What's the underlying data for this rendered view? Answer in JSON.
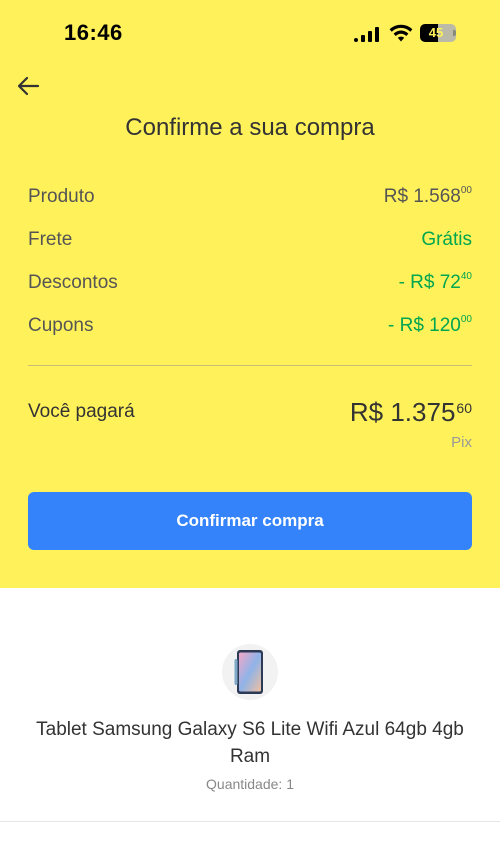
{
  "status_bar": {
    "time": "16:46",
    "battery": "45",
    "battery_level_percent": 45,
    "icons": [
      "signal-icon",
      "wifi-icon",
      "battery-icon"
    ]
  },
  "header": {
    "back_icon": "arrow-left-icon",
    "title": "Confirme a sua compra"
  },
  "summary": {
    "rows": [
      {
        "label": "Produto",
        "value": "R$ 1.568",
        "cents": "00",
        "color": "#555555"
      },
      {
        "label": "Frete",
        "value": "Grátis",
        "cents": "",
        "color": "#00a650"
      },
      {
        "label": "Descontos",
        "value": "- R$ 72",
        "cents": "40",
        "color": "#00a650"
      },
      {
        "label": "Cupons",
        "value": "- R$ 120",
        "cents": "00",
        "color": "#00a650"
      }
    ]
  },
  "payment": {
    "label": "Você pagará",
    "amount": "R$ 1.375",
    "cents": "60",
    "method": "Pix"
  },
  "confirm_button": {
    "label": "Confirmar compra",
    "color": "#3483fa"
  },
  "product": {
    "name": "Tablet Samsung Galaxy S6 Lite Wifi Azul 64gb 4gb Ram",
    "quantity": "Quantidade: 1",
    "image_icon": "tablet-icon"
  },
  "colors": {
    "background_top": "#fff159",
    "positive": "#00a650",
    "accent": "#3483fa"
  }
}
